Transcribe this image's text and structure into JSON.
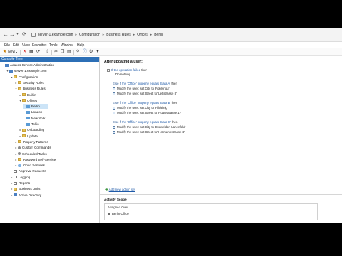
{
  "address_bar": {
    "back_icon": "back-arrow-icon",
    "forward_icon": "forward-arrow-icon",
    "breadcrumb": [
      "server-1.example.com",
      "Configuration",
      "Business Rules",
      "Offices",
      "Berlin"
    ]
  },
  "menu": [
    "File",
    "Edit",
    "View",
    "Favorites",
    "Tools",
    "Window",
    "Help"
  ],
  "toolbar": {
    "new_label": "New",
    "icons": [
      "dropdown-arrow-icon",
      "delete-icon",
      "properties-icon",
      "refresh-icon",
      "up-folder-icon",
      "cut-icon",
      "copy-icon",
      "paste-icon",
      "find-icon",
      "info-icon",
      "settings-icon",
      "filter-icon"
    ]
  },
  "tree": {
    "header": "Console Tree",
    "nodes": [
      {
        "label": "Adaxes Service Administration",
        "indent": 0,
        "icon": "server",
        "expander": ""
      },
      {
        "label": "server-1.example.com",
        "indent": 1,
        "icon": "server",
        "expander": "▾"
      },
      {
        "label": "Configuration",
        "indent": 2,
        "icon": "folder",
        "expander": "▾"
      },
      {
        "label": "Security Roles",
        "indent": 3,
        "icon": "folder",
        "expander": "▸"
      },
      {
        "label": "Business Rules",
        "indent": 3,
        "icon": "folder",
        "expander": "▾"
      },
      {
        "label": "Builtin",
        "indent": 4,
        "icon": "folder",
        "expander": "▸"
      },
      {
        "label": "Offices",
        "indent": 4,
        "icon": "folder",
        "expander": "▾"
      },
      {
        "label": "Berlin",
        "indent": 5,
        "icon": "obj",
        "expander": "",
        "selected": true
      },
      {
        "label": "London",
        "indent": 5,
        "icon": "obj",
        "expander": ""
      },
      {
        "label": "New York",
        "indent": 5,
        "icon": "obj",
        "expander": ""
      },
      {
        "label": "Tokio",
        "indent": 5,
        "icon": "obj",
        "expander": ""
      },
      {
        "label": "Onboarding",
        "indent": 4,
        "icon": "folder",
        "expander": "▸"
      },
      {
        "label": "Update",
        "indent": 4,
        "icon": "folder",
        "expander": "▸"
      },
      {
        "label": "Property Patterns",
        "indent": 3,
        "icon": "folder",
        "expander": "▸"
      },
      {
        "label": "Custom Commands",
        "indent": 3,
        "icon": "gear",
        "expander": "▸"
      },
      {
        "label": "Scheduled Tasks",
        "indent": 3,
        "icon": "gear",
        "expander": "▸"
      },
      {
        "label": "Password Self-Service",
        "indent": 3,
        "icon": "folder",
        "expander": "▸"
      },
      {
        "label": "Cloud Services",
        "indent": 3,
        "icon": "cloud",
        "expander": "▸"
      },
      {
        "label": "Approval Requests",
        "indent": 2,
        "icon": "doc",
        "expander": ""
      },
      {
        "label": "Logging",
        "indent": 2,
        "icon": "doc",
        "expander": "▸"
      },
      {
        "label": "Reports",
        "indent": 2,
        "icon": "doc",
        "expander": "▸"
      },
      {
        "label": "Business Units",
        "indent": 2,
        "icon": "folder",
        "expander": "▸"
      },
      {
        "label": "Active Directory",
        "indent": 2,
        "icon": "server",
        "expander": "▸"
      }
    ]
  },
  "rules": {
    "title": "After updating a user:",
    "if_keyword": "If",
    "if_condition": "the operation failed",
    "then_keyword": "then",
    "do_nothing": "Do nothing",
    "blocks": [
      {
        "else_if": "Else if",
        "condition": "the 'Office' property equals 'Bara A'",
        "then": "then",
        "actions": [
          "Modify the user: set City to 'Poblenou'",
          "Modify the user: set Street to 'Leitstrasse 8'"
        ]
      },
      {
        "else_if": "Else if",
        "condition": "the 'Office' property equals 'Bara B'",
        "then": "then",
        "actions": [
          "Modify the user: set City to 'Hildeinig'",
          "Modify the user: set Street to 'Hügtestrasse 17'"
        ]
      },
      {
        "else_if": "Else if",
        "condition": "the 'Office' property equals 'Bara C'",
        "then": "then",
        "actions": [
          "Modify the user: set City to 'Düsseldorf Lanenfeld'",
          "Modify the user: set Street to 'Hermannstrasse 4'"
        ]
      }
    ],
    "add_link": "Add new action set"
  },
  "activity_scope": {
    "title": "Activity Scope",
    "column_header": "Assigned Over",
    "items": [
      "Berlin Office"
    ]
  }
}
